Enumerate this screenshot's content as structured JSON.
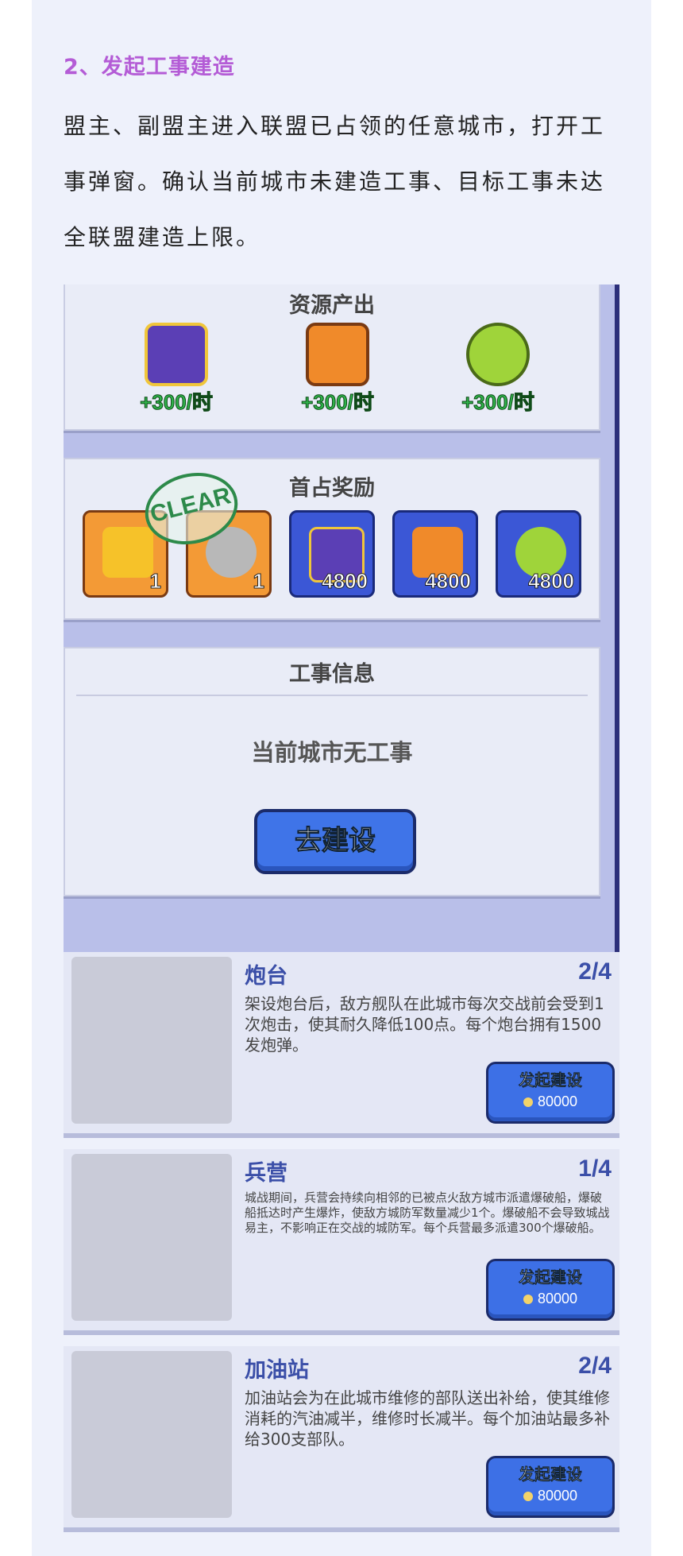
{
  "section": {
    "heading": "2、发起工事建造",
    "paragraph": "盟主、副盟主进入联盟已占领的任意城市，打开工事弹窗。确认当前城市未建造工事、目标工事未达全联盟建造上限。"
  },
  "resources": {
    "title": "资源产出",
    "items": [
      {
        "icon": "dollar-card-icon",
        "rate": "+300/时",
        "color": "#5b3fb5"
      },
      {
        "icon": "fuel-can-icon",
        "rate": "+300/时",
        "color": "#f08a2a"
      },
      {
        "icon": "beans-icon",
        "rate": "+300/时",
        "color": "#9fd43a"
      }
    ]
  },
  "first_reward": {
    "title": "首占奖励",
    "stamp": "CLEAR",
    "items": [
      {
        "icon": "gear-badge-icon",
        "count": "1",
        "style": "orange",
        "color": "#f6c229"
      },
      {
        "icon": "coin-badge-icon",
        "count": "1",
        "style": "orange",
        "color": "#b8b8b8"
      },
      {
        "icon": "dollar-card-icon",
        "count": "4800",
        "style": "blue",
        "color": "#5b3fb5"
      },
      {
        "icon": "fuel-can-icon",
        "count": "4800",
        "style": "blue",
        "color": "#f08a2a"
      },
      {
        "icon": "beans-icon",
        "count": "4800",
        "style": "blue",
        "color": "#9fd43a"
      }
    ]
  },
  "fort_info": {
    "title": "工事信息",
    "empty": "当前城市无工事",
    "button": "去建设"
  },
  "buildings": [
    {
      "name": "炮台",
      "count": "2/4",
      "description": "架设炮台后，敌方舰队在此城市每次交战前会受到1次炮击，使其耐久降低100点。每个炮台拥有1500发炮弹。",
      "desc_size": "big",
      "button": "发起建设",
      "cost": "80000",
      "icon": "turret-icon"
    },
    {
      "name": "兵营",
      "count": "1/4",
      "description": "城战期间，兵营会持续向相邻的已被点火敌方城市派遣爆破船，爆破船抵达时产生爆炸，使敌方城防军数量减少1个。爆破船不会导致城战易主，不影响正在交战的城防军。每个兵营最多派遣300个爆破船。",
      "desc_size": "small",
      "button": "发起建设",
      "cost": "80000",
      "icon": "barracks-icon"
    },
    {
      "name": "加油站",
      "count": "2/4",
      "description": "加油站会为在此城市维修的部队送出补给，使其维修消耗的汽油减半，维修时长减半。每个加油站最多补给300支部队。",
      "desc_size": "big",
      "button": "发起建设",
      "cost": "80000",
      "icon": "gas-station-icon"
    }
  ]
}
